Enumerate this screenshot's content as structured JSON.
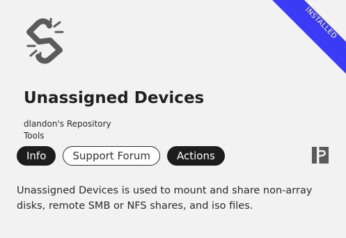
{
  "card": {
    "badge": "INSTALLED",
    "icon": "broken-link-icon",
    "title": "Unassigned Devices",
    "author": "dlandon's Repository",
    "category": "Tools",
    "buttons": {
      "info": "Info",
      "support": "Support Forum",
      "actions": "Actions"
    },
    "side_icon": "plugin-icon",
    "description": "Unassigned Devices is used to mount and share non-array disks, remote SMB or NFS shares, and iso files."
  },
  "colors": {
    "background": "#f2f2f2",
    "badge": "#3b3bf5",
    "button_dark": "#1d1d1d",
    "icon_gray": "#5b5b5b"
  }
}
